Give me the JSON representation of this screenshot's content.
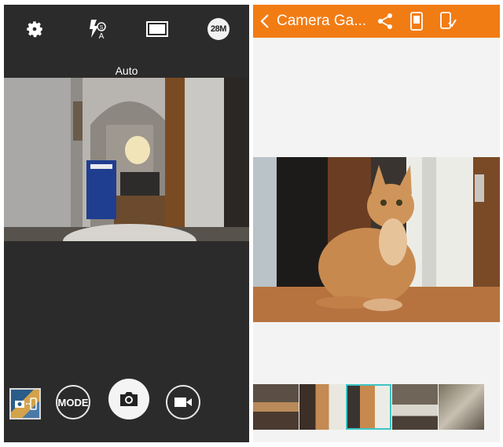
{
  "camera": {
    "top_icons": [
      "gear-icon",
      "flash-auto-icon",
      "aspect-ratio-icon"
    ],
    "resolution_badge": "28M",
    "mode_label": "Auto",
    "buttons": {
      "mode_label": "MODE",
      "shutter_icon": "camera-icon",
      "video_icon": "video-camera-icon",
      "gallery_icon": "gallery-thumbnail"
    }
  },
  "gallery": {
    "title": "Camera Ga...",
    "accent_color": "#f27c14",
    "toolbar_icons": [
      "back-chevron-icon",
      "share-icon",
      "phone-device-icon",
      "download-to-device-icon"
    ],
    "thumbnails_count": 5,
    "selected_thumbnail": 3
  }
}
